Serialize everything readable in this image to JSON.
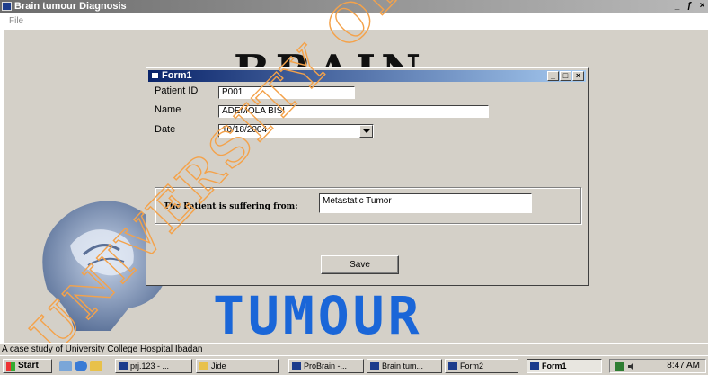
{
  "app": {
    "title": "Brain tumour Diagnosis",
    "window_controls": [
      "_",
      "ƒ",
      "×"
    ],
    "menu": [
      "File"
    ]
  },
  "background": {
    "brain_title": "BRAIN",
    "tumour_word": "TUMOUR"
  },
  "form1": {
    "title": "Form1",
    "patient_id_label": "Patient ID",
    "patient_id_value": "P001",
    "name_label": "Name",
    "name_value": "ADEMOLA BISI",
    "date_label": "Date",
    "date_value": "10/18/2004",
    "suffering_label": "The Patient is suffering from:",
    "result_value": "Metastatic Tumor",
    "save_label": "Save"
  },
  "status_text": "A case study of University College Hospital Ibadan",
  "watermark_text": "UNIVERSITY OF IBADAN LIBRARY",
  "taskbar": {
    "start_label": "Start",
    "buttons": [
      "prj.123 - ...",
      "Jide",
      "ProBrain -...",
      "Brain tum...",
      "Form2",
      "Form1"
    ],
    "clock": "8:47 AM"
  },
  "colors": {
    "accent": "#0a246a",
    "tumour_blue": "#1a66d8",
    "watermark": "#f4a24a"
  }
}
